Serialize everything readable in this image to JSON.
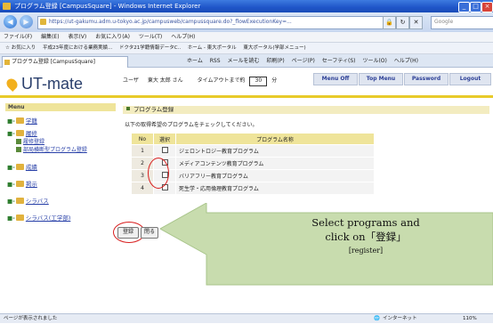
{
  "window": {
    "title": "プログラム登録 [CampusSquare] - Windows Internet Explorer",
    "buttons": {
      "minimize": "_",
      "maximize": "□",
      "close": "×"
    }
  },
  "address_bar": {
    "url": "https://ut-gakumu.adm.u-tokyo.ac.jp/campusweb/campussquare.do?_flowExecutionKey=...",
    "search_placeholder": "Google"
  },
  "menu_bar": [
    "ファイル(F)",
    "編集(E)",
    "表示(V)",
    "お気に入り(A)",
    "ツール(T)",
    "ヘルプ(H)"
  ],
  "favorites_bar": {
    "label": "お気に入り",
    "items": [
      "平成23年度における業務実績...",
      "ドクタ21学籍情報データC..",
      "ホーム - 東大ポータル",
      "東大ポータル(学部メニュー)"
    ]
  },
  "tab": {
    "label": "プログラム登録 [CampusSquare]"
  },
  "command_bar": [
    "ホーム",
    "RSS",
    "メールを読む",
    "印刷(P)",
    "ページ(P)",
    "セーフティ(S)",
    "ツール(O)",
    "ヘルプ(H)"
  ],
  "header": {
    "logo": "UT-mate",
    "user_label": "ユーザ",
    "user_name": "東大 太郎 さん",
    "timeout_label": "タイムアウトまで約",
    "timeout_value": "30",
    "timeout_unit": "分",
    "buttons": {
      "menu_off": "Menu Off",
      "top_menu": "Top Menu",
      "password": "Password",
      "logout": "Logout"
    }
  },
  "sidebar": {
    "title": "Menu",
    "items": [
      {
        "label": "学籍"
      },
      {
        "label": "履修",
        "subitems": [
          "履修登録",
          "部局横断型プログラム登録"
        ]
      },
      {
        "label": "成績"
      },
      {
        "label": "掲示"
      },
      {
        "label": "シラバス"
      },
      {
        "label": "シラバス(工学部)"
      }
    ]
  },
  "content": {
    "title": "プログラム登録",
    "instruction": "以下の取得希望のプログラムをチェックしてください。",
    "table": {
      "headers": [
        "No",
        "選択",
        "プログラム名称"
      ],
      "rows": [
        {
          "no": "1",
          "name": "ジェロントロジー教育プログラム"
        },
        {
          "no": "2",
          "name": "メディアコンテンツ教育プログラム"
        },
        {
          "no": "3",
          "name": "バリアフリー教育プログラム"
        },
        {
          "no": "4",
          "name": "死生学・応用倫理教育プログラム"
        }
      ]
    },
    "register_button": "登録",
    "close_button": "閉る"
  },
  "callout": {
    "line1": "Select programs and",
    "line2": "click on「登録」",
    "line3": "[register]"
  },
  "status_bar": {
    "left": "ページが表示されました",
    "zone": "インターネット",
    "zoom": "110%"
  },
  "colors": {
    "title_bar": "#1f55c8",
    "accent_yellow": "#e8ca2a",
    "sidebar_header": "#efe49a",
    "link": "#2840a8",
    "annotation_red": "#d81e1e",
    "callout_green": "#c8dcae"
  }
}
